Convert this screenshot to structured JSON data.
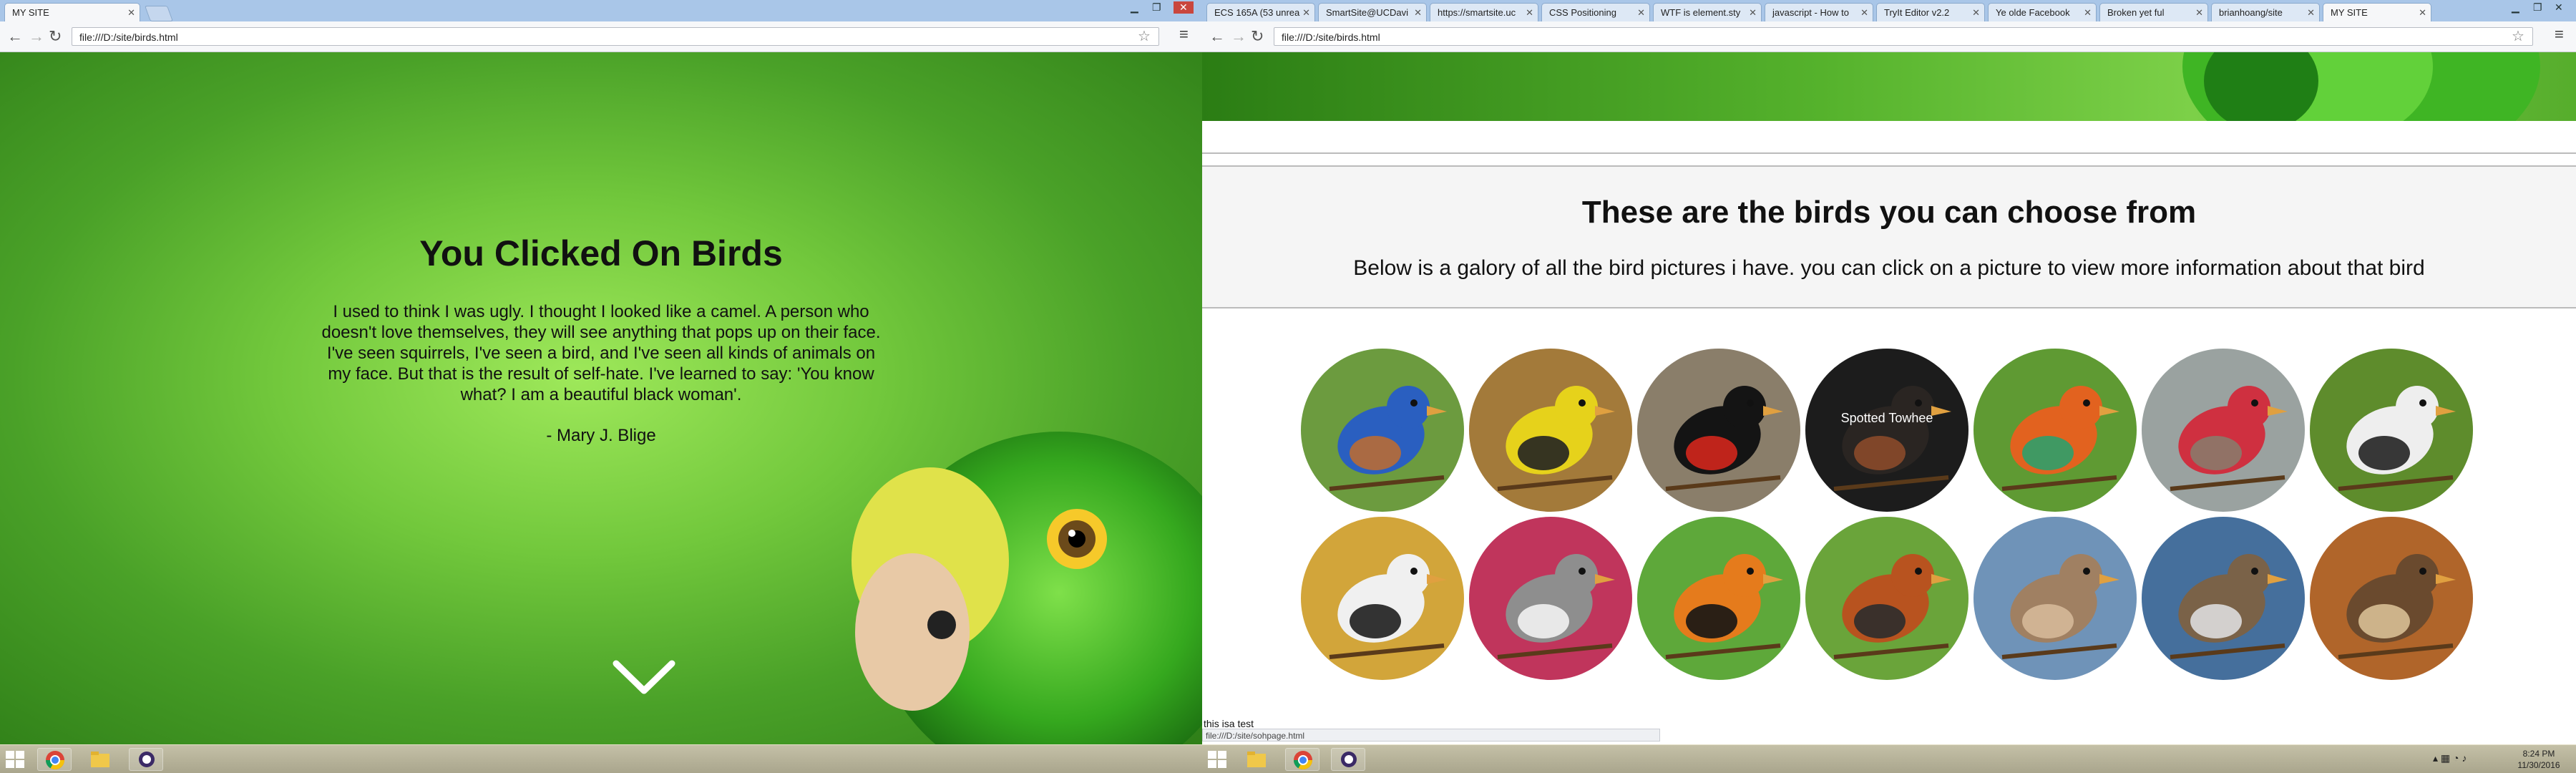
{
  "left": {
    "tab_title": "MY SITE",
    "url": "file:///D:/site/birds.html",
    "hero": {
      "title": "You Clicked On Birds",
      "quote": "I used to think I was ugly. I thought I looked like a camel. A person who doesn't love themselves, they will see anything that pops up on their face. I've seen squirrels, I've seen a bird, and I've seen all kinds of animals on my face. But that is the result of self-hate. I've learned to say: 'You know what? I am a beautiful black woman'.",
      "author": "- Mary J. Blige"
    }
  },
  "right": {
    "tabs": [
      {
        "label": "ECS 165A (53 unrea"
      },
      {
        "label": "SmartSite@UCDavi"
      },
      {
        "label": "https://smartsite.uc"
      },
      {
        "label": "CSS Positioning"
      },
      {
        "label": "WTF is element.sty"
      },
      {
        "label": "javascript - How to"
      },
      {
        "label": "TryIt Editor v2.2"
      },
      {
        "label": "Ye olde Facebook"
      },
      {
        "label": "Broken yet ful"
      },
      {
        "label": "brianhoang/site"
      },
      {
        "label": "MY SITE"
      }
    ],
    "url": "file:///D:/site/birds.html",
    "heading": "These are the birds you can choose from",
    "subheading": "Below is a galory of all the bird pictures i have. you can click on a picture to view more information about that bird",
    "birds": [
      {
        "label": "",
        "bg": "#6c9b3f",
        "body": "#2a5fc0",
        "accent": "#b86b35"
      },
      {
        "label": "",
        "bg": "#a37a3a",
        "body": "#e6d21b",
        "accent": "#222222"
      },
      {
        "label": "",
        "bg": "#8a7e6a",
        "body": "#141414",
        "accent": "#d2261c"
      },
      {
        "label": "Spotted Towhee",
        "bg": "#1c1c1c",
        "body": "#2a2522",
        "accent": "#8a4a2a"
      },
      {
        "label": "",
        "bg": "#5f9a33",
        "body": "#e2621f",
        "accent": "#2fa06a"
      },
      {
        "label": "",
        "bg": "#9aa2a0",
        "body": "#cf3040",
        "accent": "#8a7a6a"
      },
      {
        "label": "",
        "bg": "#5e8c2c",
        "body": "#eeeeee",
        "accent": "#222222"
      },
      {
        "label": "",
        "bg": "#d2a53a",
        "body": "#f0f0f0",
        "accent": "#1e1e1e"
      },
      {
        "label": "",
        "bg": "#c0355c",
        "body": "#8e8e8e",
        "accent": "#f2f2f2"
      },
      {
        "label": "",
        "bg": "#5ea83a",
        "body": "#e57b1c",
        "accent": "#151515"
      },
      {
        "label": "",
        "bg": "#6aa43a",
        "body": "#b8531f",
        "accent": "#2c2c2c"
      },
      {
        "label": "",
        "bg": "#6f93b8",
        "body": "#a08062",
        "accent": "#d5b899"
      },
      {
        "label": "",
        "bg": "#456f9c",
        "body": "#7a6248",
        "accent": "#dddddd"
      },
      {
        "label": "",
        "bg": "#b0652a",
        "body": "#6a4a2e",
        "accent": "#d8bf95"
      }
    ],
    "footer_text": "this isa test",
    "status_url": "file:///D:/site/sohpage.html",
    "clock_time": "8:24 PM",
    "clock_date": "11/30/2016"
  },
  "colors": {
    "page_green_light": "#9ee85a",
    "page_green_dark": "#2f7f18",
    "taskbar": "#b5b197"
  },
  "icons": [
    "chevron-down-icon",
    "back-arrow-icon",
    "forward-arrow-icon",
    "reload-icon",
    "star-icon",
    "menu-icon",
    "windows-start-icon",
    "chrome-icon",
    "file-explorer-icon"
  ]
}
